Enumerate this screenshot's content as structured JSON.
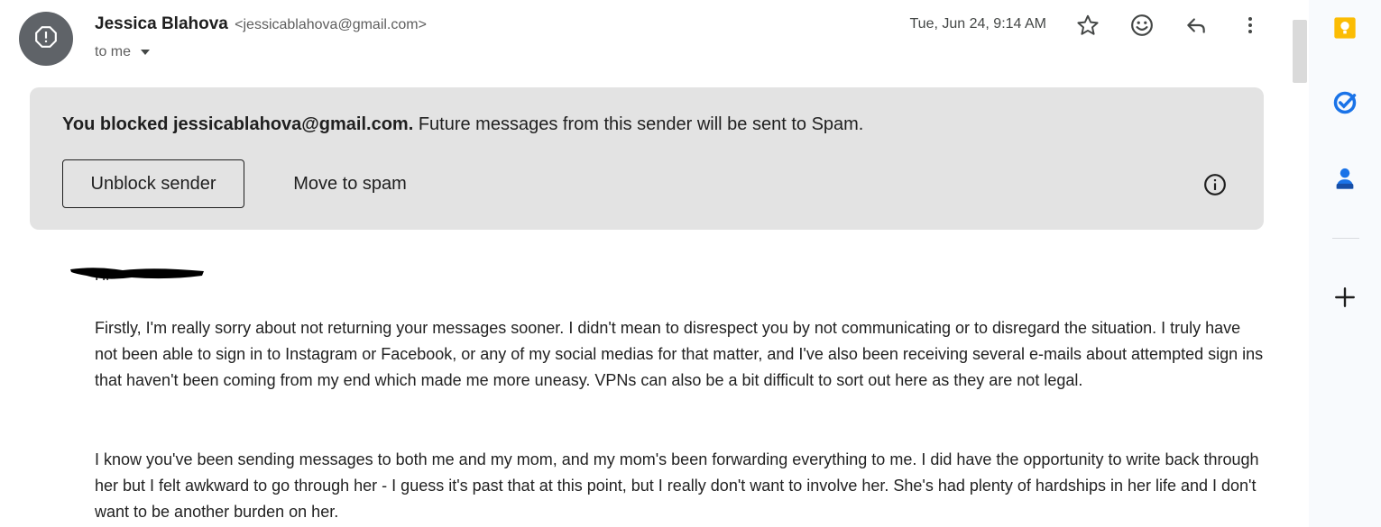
{
  "header": {
    "sender_name": "Jessica Blahova",
    "sender_email": "<jessicablahova@gmail.com>",
    "to_label": "to me",
    "date": "Tue, Jun 24, 9:14 AM",
    "icons": [
      "warning-icon",
      "star-icon",
      "emoji-icon",
      "reply-icon",
      "more-vert-icon",
      "chevron-down-icon"
    ]
  },
  "banner": {
    "bold_text": "You blocked jessicablahova@gmail.com.",
    "text": " Future messages from this sender will be sent to Spam.",
    "unblock_label": "Unblock sender",
    "spam_label": "Move to spam",
    "info_icon": "info-icon",
    "background": "#e3e3e3"
  },
  "body": {
    "greeting": "Hi",
    "paragraphs": [
      "Firstly, I'm really sorry about not returning your messages sooner. I didn't mean to disrespect you by not communicating or to disregard the situation. I truly have not been able to sign in to Instagram or Facebook, or any of my social medias for that matter, and I've also been receiving several e-mails about attempted sign ins that haven't been coming from my end which made me more uneasy. VPNs can also be a bit difficult to sort out here as they are not legal.",
      "I know you've been sending messages to both me and my mom, and my mom's been forwarding everything to me. I did have the opportunity to write back through her but I felt awkward to go through her - I guess it's past that at this point, but I really don't want to involve her. She's had plenty of hardships in her life and I don't want to be another burden on her."
    ]
  },
  "side_panel": {
    "icons": [
      "keep-icon",
      "tasks-icon",
      "contacts-icon",
      "add-icon"
    ],
    "colors": {
      "keep": "#fbbc04",
      "tasks": "#1a73e8",
      "contacts": "#1a73e8"
    }
  }
}
